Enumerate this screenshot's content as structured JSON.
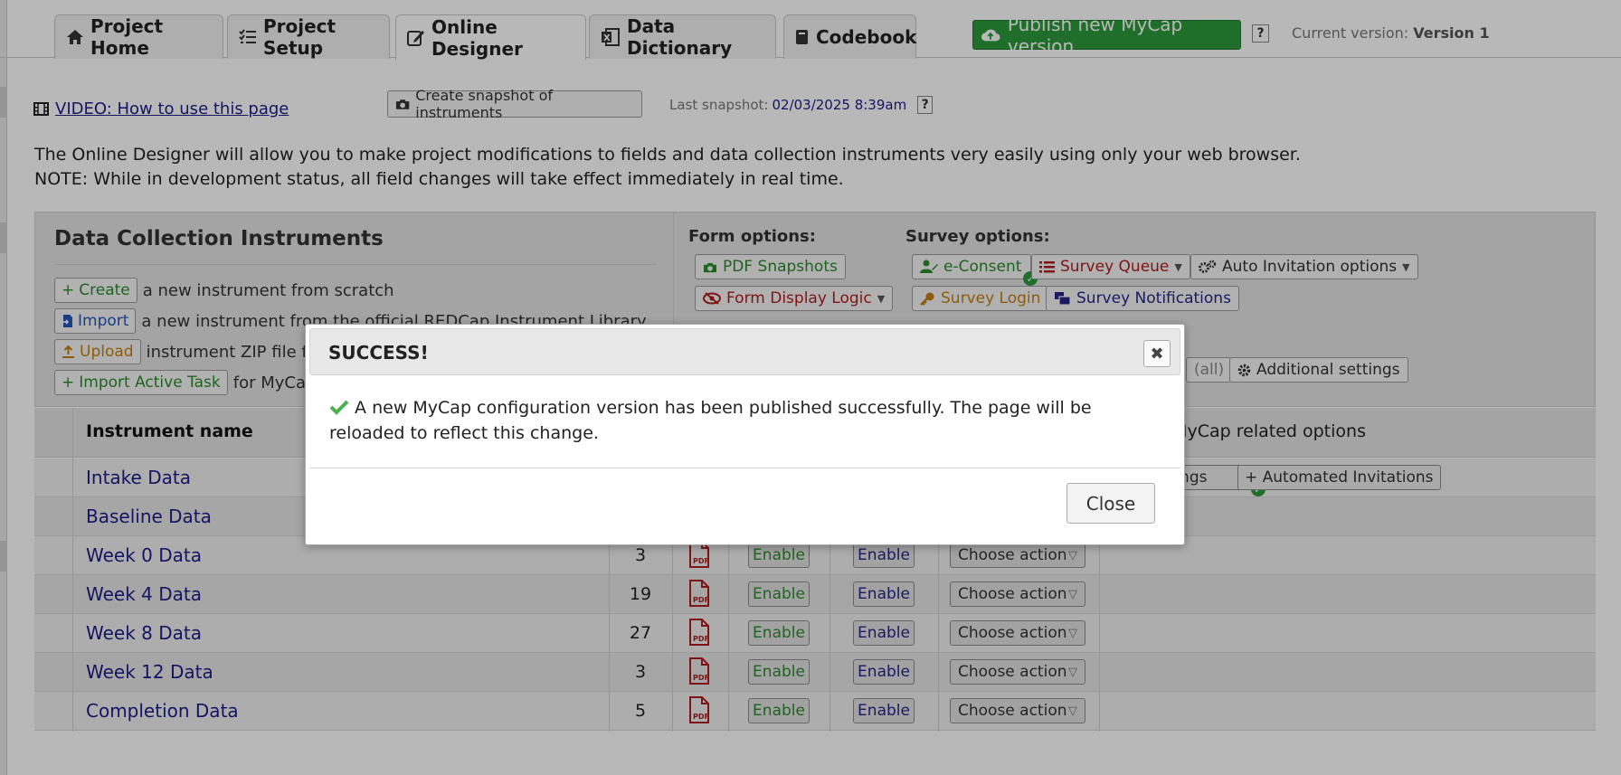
{
  "tabs": [
    {
      "label": "Project Home",
      "icon": "home-icon"
    },
    {
      "label": "Project Setup",
      "icon": "checklist-icon"
    },
    {
      "label": "Online Designer",
      "icon": "edit-icon"
    },
    {
      "label": "Data Dictionary",
      "icon": "excel-icon"
    },
    {
      "label": "Codebook",
      "icon": "book-icon"
    }
  ],
  "publish": {
    "label": "Publish new MyCap version",
    "help": "?"
  },
  "version": {
    "label": "Current version:",
    "value": "Version 1"
  },
  "video": {
    "label": "VIDEO: How to use this page"
  },
  "snapshot": {
    "button": "Create snapshot of instruments",
    "last_label": "Last snapshot:",
    "last_value": "02/03/2025 8:39am",
    "help": "?"
  },
  "intro": {
    "line1": "The Online Designer will allow you to make project modifications to fields and data collection instruments very easily using only your web browser.",
    "line2": "NOTE: While in development status, all field changes will take effect immediately in real time."
  },
  "panel": {
    "title": "Data Collection Instruments",
    "actions": [
      {
        "button": "Create",
        "text": "a new instrument from scratch"
      },
      {
        "button": "Import",
        "text": "a new instrument from the official REDCap Instrument Library"
      },
      {
        "button": "Upload",
        "text": "instrument ZIP file from"
      },
      {
        "button": "Import Active Task",
        "text": "for MyCap"
      }
    ],
    "form_options_label": "Form options:",
    "survey_options_label": "Survey options:",
    "form_buttons": {
      "pdf": "PDF Snapshots",
      "display_logic": "Form Display Logic"
    },
    "survey_buttons": {
      "econsent": "e-Consent",
      "queue": "Survey Queue",
      "auto": "Auto Invitation options",
      "login": "Survey Login",
      "notifications": "Survey Notifications",
      "all": "(all)",
      "additional": "Additional settings"
    }
  },
  "table": {
    "header_name": "Instrument name",
    "header_options": "d MyCap related options",
    "row_buttons": {
      "settings": "ttings",
      "auto_inv": "+ Automated Invitations"
    },
    "enable": "Enable",
    "choose": "Choose action",
    "rows": [
      {
        "name": "Intake Data",
        "fields": ""
      },
      {
        "name": "Baseline Data",
        "fields": ""
      },
      {
        "name": "Week 0 Data",
        "fields": "3"
      },
      {
        "name": "Week 4 Data",
        "fields": "19"
      },
      {
        "name": "Week 8 Data",
        "fields": "27"
      },
      {
        "name": "Week 12 Data",
        "fields": "3"
      },
      {
        "name": "Completion Data",
        "fields": "5"
      }
    ]
  },
  "modal": {
    "title": "SUCCESS!",
    "message": "A new MyCap configuration version has been published successfully. The page will be reloaded to reflect this change.",
    "close_label": "Close",
    "x_label": "✖"
  }
}
